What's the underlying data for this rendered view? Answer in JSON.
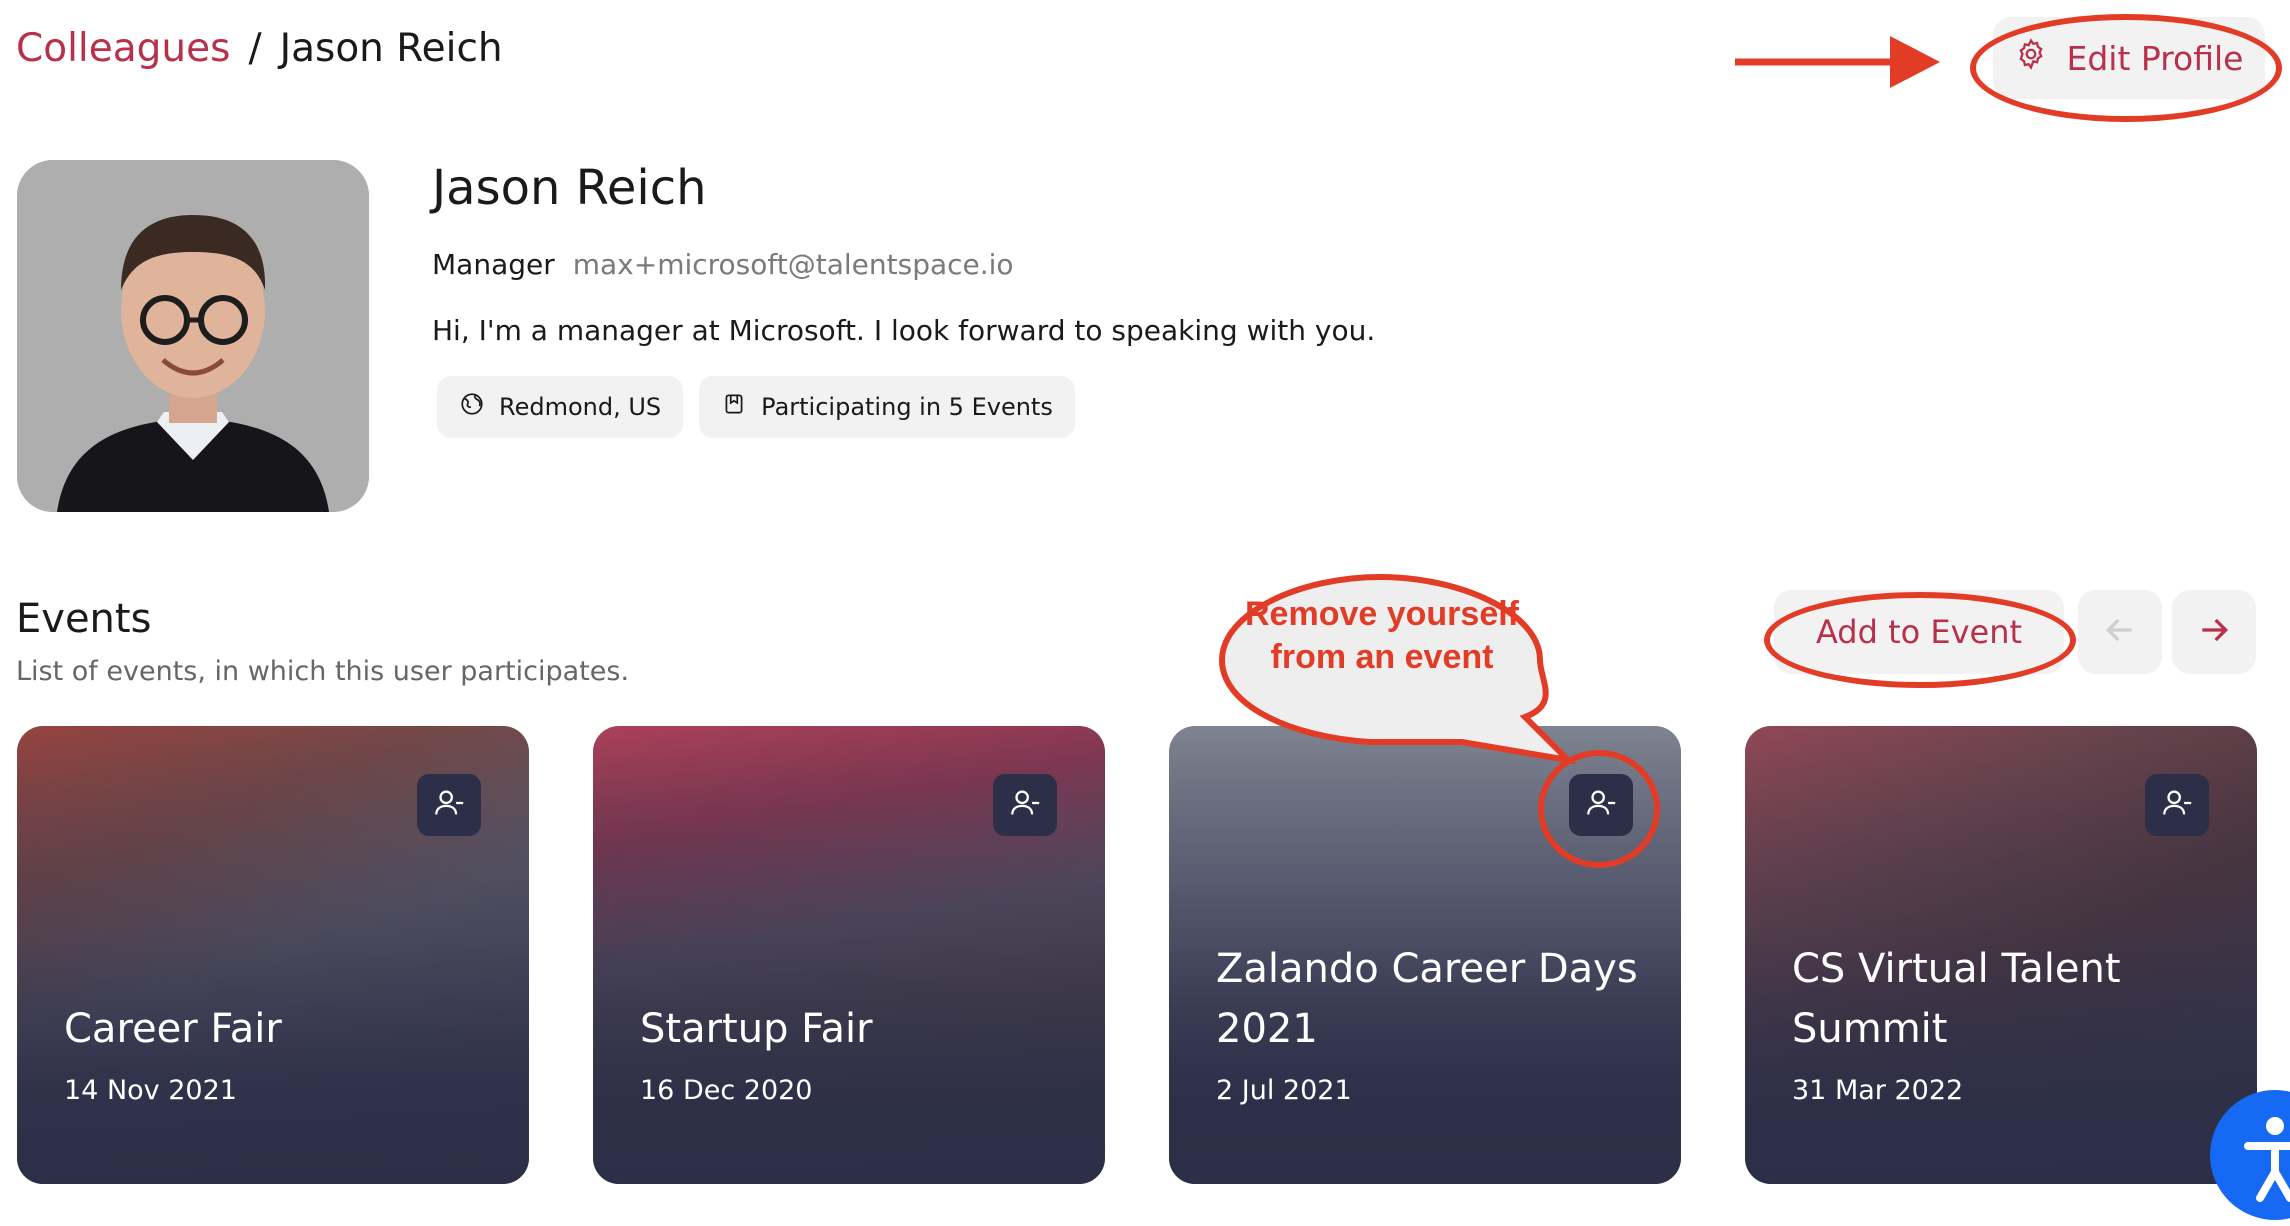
{
  "breadcrumb": {
    "parent": "Colleagues",
    "separator": "/",
    "current": "Jason Reich"
  },
  "header": {
    "edit_profile_label": "Edit Profile"
  },
  "profile": {
    "name": "Jason Reich",
    "role": "Manager",
    "email": "max+microsoft@talentspace.io",
    "bio": "Hi, I'm a manager at Microsoft. I look forward to speaking with you.",
    "location": "Redmond, US",
    "participation": "Participating in 5 Events"
  },
  "events": {
    "title": "Events",
    "subtitle": "List of events, in which this user participates.",
    "add_label": "Add to Event",
    "cards": [
      {
        "title": "Career Fair",
        "date": "14 Nov 2021"
      },
      {
        "title": "Startup Fair",
        "date": "16 Dec 2020"
      },
      {
        "title": "Zalando Career Days 2021",
        "date": "2 Jul 2021"
      },
      {
        "title": "CS Virtual Talent Summit",
        "date": "31 Mar 2022"
      }
    ]
  },
  "annotation": {
    "callout": "Remove yourself from an event"
  },
  "colors": {
    "accent": "#b8304a",
    "annotation": "#e23b26",
    "card_overlay": "#2d2f48",
    "button_bg": "#f2f2f2"
  },
  "icons": [
    "gear-icon",
    "globe-icon",
    "bookmark-icon",
    "arrow-left-icon",
    "arrow-right-icon",
    "user-minus-icon",
    "accessibility-icon"
  ]
}
